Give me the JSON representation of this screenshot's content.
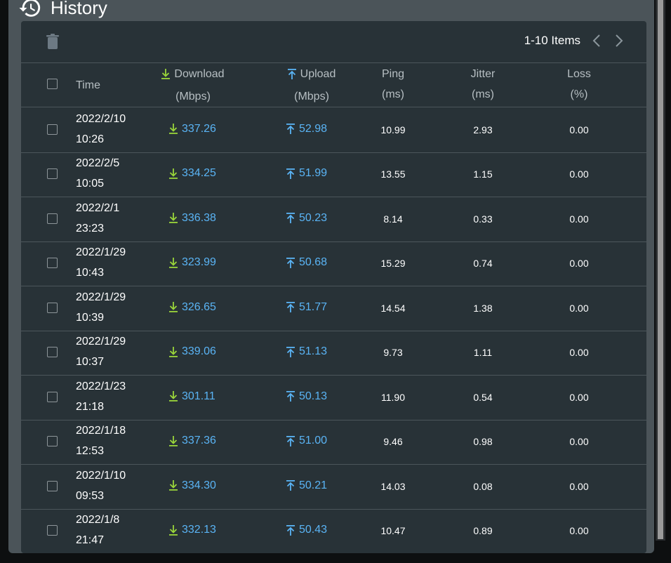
{
  "title": "History",
  "pager": {
    "label": "1-10 Items"
  },
  "columns": {
    "time": "Time",
    "download": "Download",
    "download_unit": "(Mbps)",
    "upload": "Upload",
    "upload_unit": "(Mbps)",
    "ping": "Ping",
    "ping_unit": "(ms)",
    "jitter": "Jitter",
    "jitter_unit": "(ms)",
    "loss": "Loss",
    "loss_unit": "(%)"
  },
  "rows": [
    {
      "date": "2022/2/10",
      "time": "10:26",
      "download": "337.26",
      "upload": "52.98",
      "ping": "10.99",
      "jitter": "2.93",
      "loss": "0.00"
    },
    {
      "date": "2022/2/5",
      "time": "10:05",
      "download": "334.25",
      "upload": "51.99",
      "ping": "13.55",
      "jitter": "1.15",
      "loss": "0.00"
    },
    {
      "date": "2022/2/1",
      "time": "23:23",
      "download": "336.38",
      "upload": "50.23",
      "ping": "8.14",
      "jitter": "0.33",
      "loss": "0.00"
    },
    {
      "date": "2022/1/29",
      "time": "10:43",
      "download": "323.99",
      "upload": "50.68",
      "ping": "15.29",
      "jitter": "0.74",
      "loss": "0.00"
    },
    {
      "date": "2022/1/29",
      "time": "10:39",
      "download": "326.65",
      "upload": "51.77",
      "ping": "14.54",
      "jitter": "1.38",
      "loss": "0.00"
    },
    {
      "date": "2022/1/29",
      "time": "10:37",
      "download": "339.06",
      "upload": "51.13",
      "ping": "9.73",
      "jitter": "1.11",
      "loss": "0.00"
    },
    {
      "date": "2022/1/23",
      "time": "21:18",
      "download": "301.11",
      "upload": "50.13",
      "ping": "11.90",
      "jitter": "0.54",
      "loss": "0.00"
    },
    {
      "date": "2022/1/18",
      "time": "12:53",
      "download": "337.36",
      "upload": "51.00",
      "ping": "9.46",
      "jitter": "0.98",
      "loss": "0.00"
    },
    {
      "date": "2022/1/10",
      "time": "09:53",
      "download": "334.30",
      "upload": "50.21",
      "ping": "14.03",
      "jitter": "0.08",
      "loss": "0.00"
    },
    {
      "date": "2022/1/8",
      "time": "21:47",
      "download": "332.13",
      "upload": "50.43",
      "ping": "10.47",
      "jitter": "0.89",
      "loss": "0.00"
    }
  ],
  "colors": {
    "download_arrow": "#9ad53a",
    "upload_arrow": "#5ab4f5",
    "value_link": "#5ab4f5"
  },
  "icons": {
    "title": "history-icon",
    "toolbar": "trash-icon",
    "prev": "chevron-left-icon",
    "next": "chevron-right-icon"
  }
}
